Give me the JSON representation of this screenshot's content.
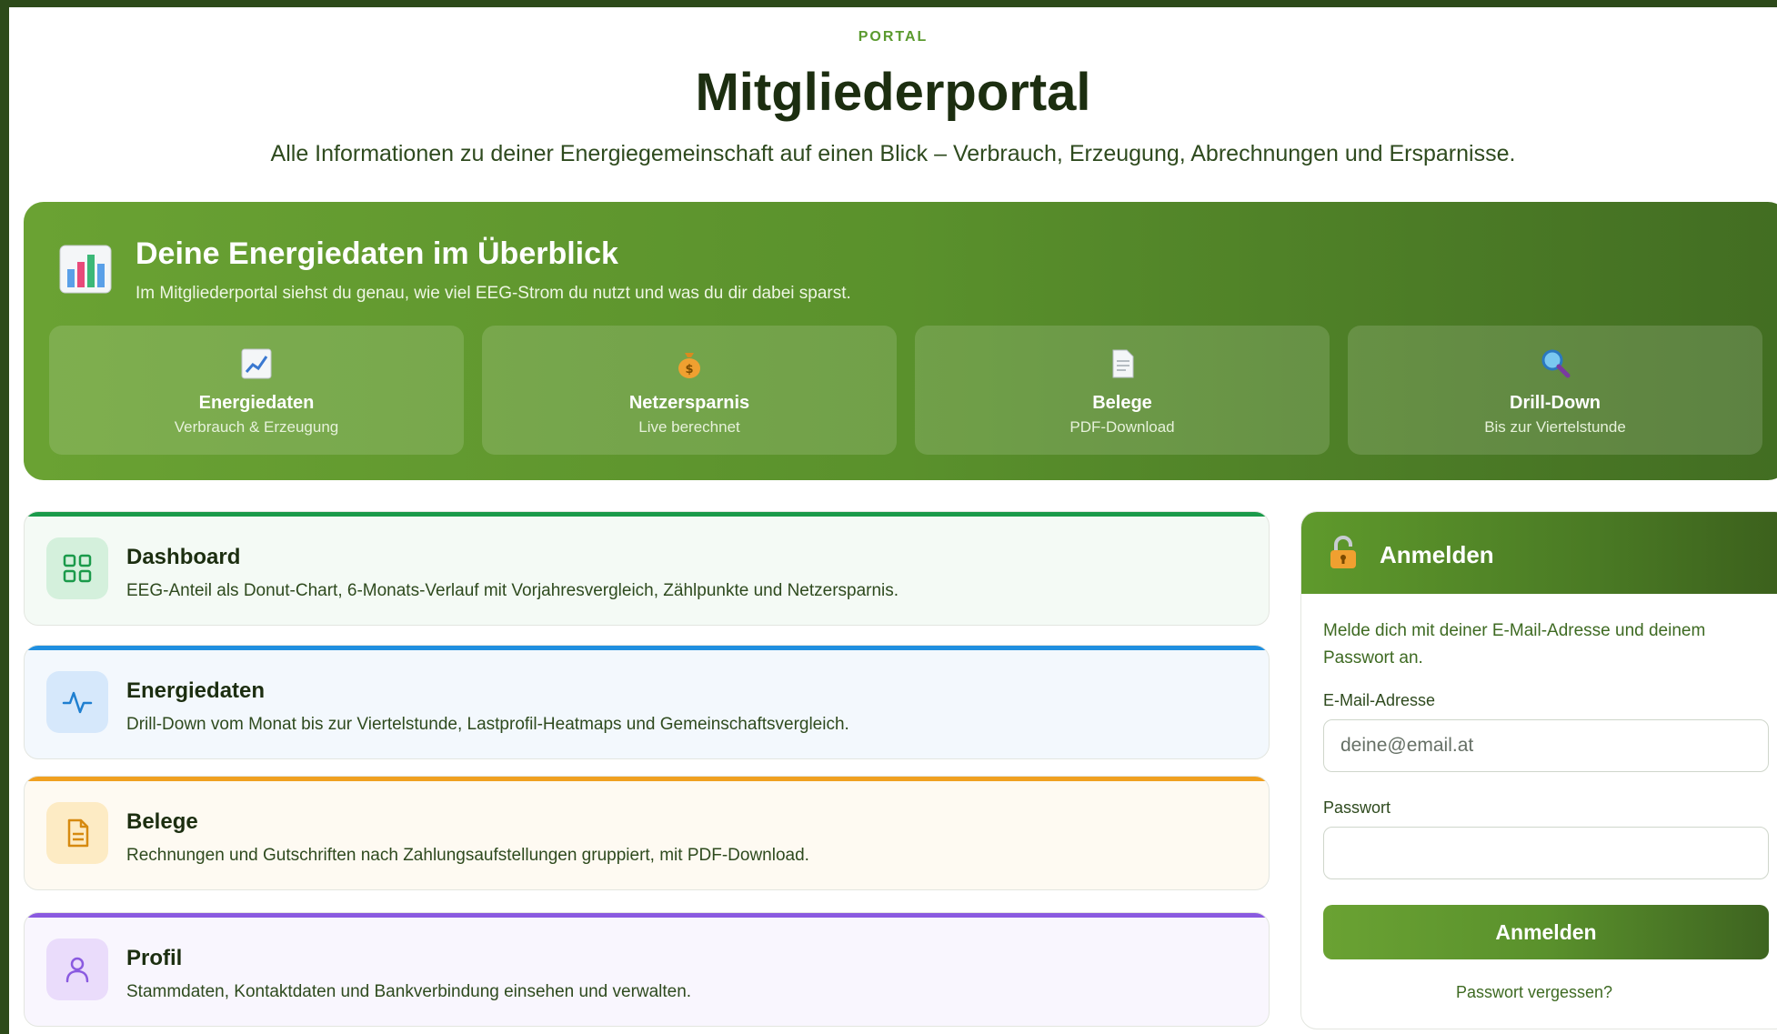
{
  "header": {
    "kicker": "PORTAL",
    "title": "Mitgliederportal",
    "subtitle": "Alle Informationen zu deiner Energiegemeinschaft auf einen Blick – Verbrauch, Erzeugung, Abrechnungen und Ersparnisse."
  },
  "hero": {
    "icon": "bar-chart-icon",
    "title": "Deine Energiedaten im Überblick",
    "subtitle": "Im Mitgliederportal siehst du genau, wie viel EEG-Strom du nutzt und was du dir dabei sparst.",
    "cards": [
      {
        "icon": "line-chart-icon",
        "label": "Energiedaten",
        "sub": "Verbrauch & Erzeugung"
      },
      {
        "icon": "money-bag-icon",
        "label": "Netzersparnis",
        "sub": "Live berechnet"
      },
      {
        "icon": "document-icon",
        "label": "Belege",
        "sub": "PDF-Download"
      },
      {
        "icon": "magnifier-icon",
        "label": "Drill-Down",
        "sub": "Bis zur Viertelstunde"
      }
    ]
  },
  "features": [
    {
      "icon": "grid-icon",
      "title": "Dashboard",
      "desc": "EEG-Anteil als Donut-Chart, 6-Monats-Verlauf mit Vorjahresvergleich, Zählpunkte und Netzersparnis.",
      "accent": "#1a9a4a"
    },
    {
      "icon": "activity-icon",
      "title": "Energiedaten",
      "desc": "Drill-Down vom Monat bis zur Viertelstunde, Lastprofil-Heatmaps und Gemeinschaftsvergleich.",
      "accent": "#1f8fe0"
    },
    {
      "icon": "file-text-icon",
      "title": "Belege",
      "desc": "Rechnungen und Gutschriften nach Zahlungsaufstellungen gruppiert, mit PDF-Download.",
      "accent": "#f0a020"
    },
    {
      "icon": "user-icon",
      "title": "Profil",
      "desc": "Stammdaten, Kontaktdaten und Bankverbindung einsehen und verwalten.",
      "accent": "#8a5ae0"
    }
  ],
  "login": {
    "icon": "lock-icon",
    "title": "Anmelden",
    "intro": "Melde dich mit deiner E-Mail-Adresse und deinem Passwort an.",
    "email_label": "E-Mail-Adresse",
    "email_placeholder": "deine@email.at",
    "email_value": "",
    "password_label": "Passwort",
    "password_value": "",
    "submit_label": "Anmelden",
    "forgot_label": "Passwort vergessen?"
  },
  "colors": {
    "brand_green": "#5a912c",
    "dark_green": "#2d4a1a"
  }
}
